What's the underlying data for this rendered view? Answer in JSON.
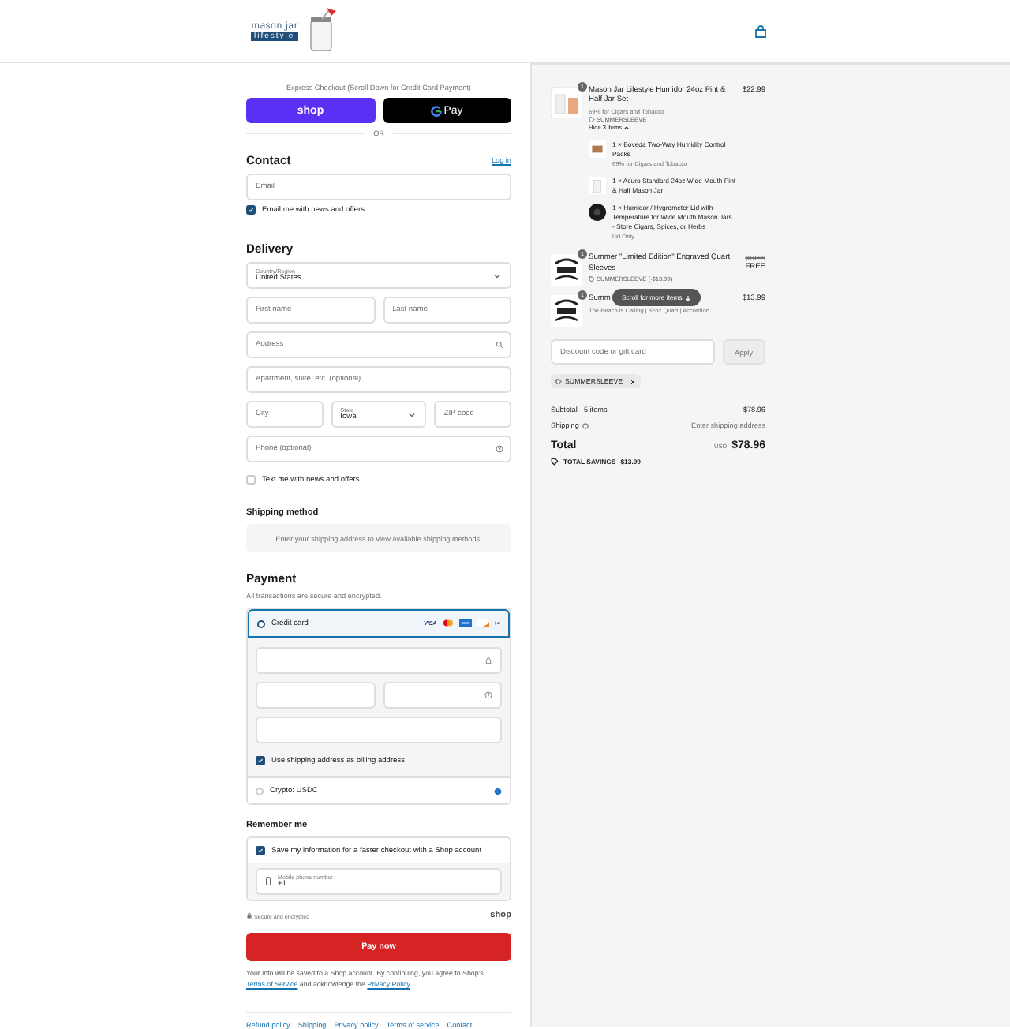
{
  "logo": {
    "top": "mason jar",
    "bottom": "lifestyle"
  },
  "express": {
    "caption": "Express Checkout (Scroll Down for Credit Card Payment)",
    "buttons": [
      {
        "kind": "shop",
        "label": "shop"
      },
      {
        "kind": "gpay",
        "label": "Pay"
      }
    ],
    "divider": "OR"
  },
  "contact": {
    "heading": "Contact",
    "login": "Log in",
    "email_placeholder": "Email",
    "newsletter": {
      "label": "Email me with news and offers",
      "checked": true
    }
  },
  "delivery": {
    "heading": "Delivery",
    "rows": [
      [
        {
          "kind": "select",
          "label": "Country/Region",
          "value": "United States"
        }
      ],
      [
        {
          "kind": "text",
          "placeholder": "First name"
        },
        {
          "kind": "text",
          "placeholder": "Last name"
        }
      ],
      [
        {
          "kind": "text",
          "placeholder": "Address"
        }
      ],
      [
        {
          "kind": "text",
          "placeholder": "Apartment, suite, etc. (optional)"
        }
      ],
      [
        {
          "kind": "text",
          "placeholder": "City"
        },
        {
          "kind": "select",
          "label": "State",
          "value": "Iowa"
        },
        {
          "kind": "text",
          "placeholder": "ZIP code"
        }
      ],
      [
        {
          "kind": "text",
          "placeholder": "Phone (optional)"
        }
      ]
    ],
    "sms": {
      "label": "Text me with news and offers",
      "checked": false
    }
  },
  "shipping_method": {
    "heading": "Shipping method",
    "notice": "Enter your shipping address to view available shipping methods."
  },
  "payment": {
    "heading": "Payment",
    "subtitle": "All transactions are secure and encrypted.",
    "methods": [
      {
        "kind": "card",
        "label": "Credit card",
        "selected": true
      },
      {
        "kind": "crypto",
        "label": "Crypto: USDC",
        "selected": false
      }
    ],
    "card_brands": [
      {
        "kind": "visa",
        "label": "VISA"
      },
      {
        "kind": "mastercard"
      },
      {
        "kind": "amex"
      },
      {
        "kind": "discover"
      },
      {
        "kind": "more",
        "label": "+4"
      }
    ],
    "billing_same": {
      "label": "Use shipping address as billing address",
      "checked": true
    }
  },
  "remember": {
    "heading": "Remember me",
    "save": {
      "label": "Save my information for a faster checkout with a Shop account",
      "checked": true
    },
    "phone": {
      "label": "Mobile phone number",
      "value": "+1"
    }
  },
  "secure_note": "Secure and encrypted",
  "shop_mark": "shop",
  "pay_button": "Pay now",
  "legal": {
    "before": "Your info will be saved to a Shop account. By continuing, you agree to Shop's",
    "link1": "Terms of Service",
    "middle": "and acknowledge the",
    "link2": "Privacy Policy",
    "after": "."
  },
  "footer_links": [
    "Refund policy",
    "Shipping",
    "Privacy policy",
    "Terms of service",
    "Contact"
  ],
  "summary": {
    "items": [
      {
        "kind": "bundle",
        "quantity": "1",
        "title": "Mason Jar Lifestyle Humidor 24oz Pint & Half Jar Set",
        "variant": "69% for Cigars and Tobacco",
        "discount": "SUMMERSLEEVE",
        "toggle": "Hide 3 items",
        "expanded": true,
        "price": "$22.99",
        "components": [
          {
            "kind": "pack",
            "text": "1 × Boveda Two-Way Humidity Control Packs",
            "variant": "69% for Cigars and Tobacco"
          },
          {
            "kind": "jar",
            "text": "1 × Acuro Standard 24oz Wide Mouth Pint & Half Mason Jar"
          },
          {
            "kind": "lid",
            "text": "1 × Humidor / Hygrometer Lid with Temperature for Wide Mouth Mason Jars - Store Cigars, Spices, or Herbs",
            "variant": "Lid Only"
          }
        ]
      },
      {
        "kind": "sleeve",
        "quantity": "1",
        "title": "Summer \"Limited Edition\" Engraved Quart Sleeves",
        "discount": "SUMMERSLEEVE (-$13.99)",
        "compare_price": "$13.99",
        "price": "FREE"
      },
      {
        "kind": "sleeve",
        "quantity": "1",
        "title": "Summ",
        "subtitle": "The Beach is Calling | 32oz Quart | Accordion",
        "price": "$13.99"
      }
    ],
    "scroll_hint": "Scroll for more items",
    "discount_placeholder": "Discount code or gift card",
    "apply": "Apply",
    "applied_code": "SUMMERSLEEVE",
    "subtotal": {
      "label": "Subtotal · 5 items",
      "value": "$78.96"
    },
    "shipping": {
      "label": "Shipping",
      "value": "Enter shipping address"
    },
    "total": {
      "label": "Total",
      "currency": "USD",
      "value": "$78.96"
    },
    "savings": {
      "label": "TOTAL SAVINGS",
      "value": "$13.99"
    }
  }
}
